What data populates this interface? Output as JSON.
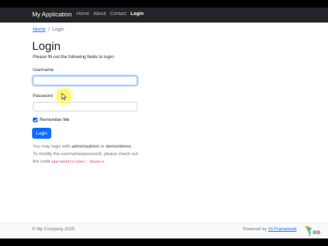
{
  "navbar": {
    "brand": "My Application",
    "items": [
      {
        "label": "Home",
        "active": false
      },
      {
        "label": "About",
        "active": false
      },
      {
        "label": "Contact",
        "active": false
      },
      {
        "label": "Login",
        "active": true
      }
    ]
  },
  "breadcrumb": {
    "home": "Home",
    "separator": "/",
    "current": "Login"
  },
  "main": {
    "title": "Login",
    "intro": "Please fill out the following fields to login:",
    "username_label": "Username",
    "username_value": "",
    "password_label": "Password",
    "password_value": "",
    "remember_label": "Remember Me",
    "remember_checked": true,
    "login_button": "Login"
  },
  "hint": {
    "line1_prefix": "You may login with ",
    "line1_cred1": "admin/admin",
    "line1_or": " or ",
    "line1_cred2": "demo/demo",
    "line1_suffix": ".",
    "line2": "To modify the username/password, please check out",
    "line3_prefix": "the code ",
    "line3_code": "app\\models\\User::$users",
    "line3_suffix": "."
  },
  "footer": {
    "copyright": "© My Company 2025",
    "powered_prefix": "Powered by ",
    "powered_link": "Yii Framework"
  },
  "colors": {
    "navbar_bg": "#212529",
    "primary": "#0d6efd",
    "footer_bg": "#f8f9fa",
    "code": "#d63384"
  },
  "icons": [
    "mouse-cursor-icon",
    "checkmark-icon",
    "yii-logo-icon"
  ]
}
